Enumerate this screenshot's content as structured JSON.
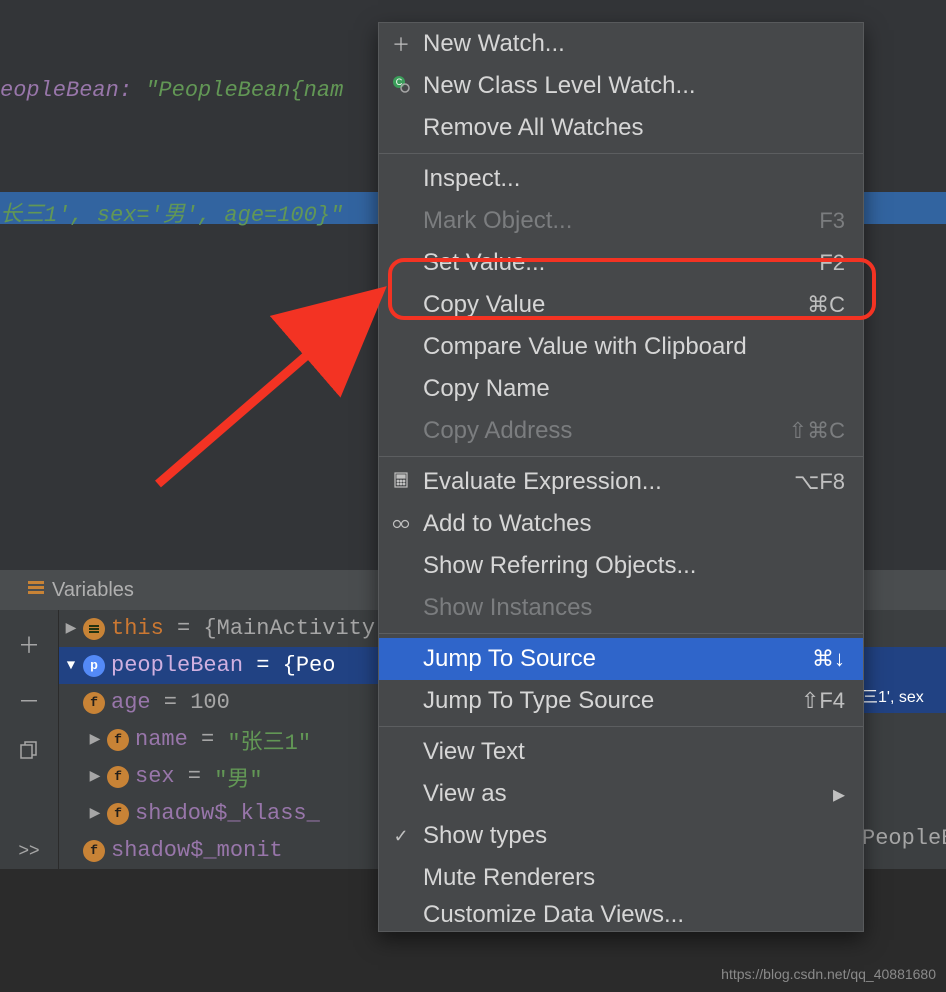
{
  "watch": {
    "line1_prefix": "eopleBean: ",
    "line1_value": "\"PeopleBean{nam",
    "line2": "长三1', sex='男', age=100}\""
  },
  "variablesPanel": {
    "title": "Variables"
  },
  "tree": {
    "this": {
      "name": "this",
      "sep": " = ",
      "value": "{MainActivity"
    },
    "peopleBean": {
      "name": "peopleBean",
      "sep": " = ",
      "value": "{Peo",
      "tail": "三1', sex"
    },
    "age": {
      "name": "age",
      "sep": " = ",
      "value": "100"
    },
    "nameF": {
      "name": "name",
      "sep": " = ",
      "value": "\"张三1\""
    },
    "sex": {
      "name": "sex",
      "sep": " = ",
      "value": "\"男\""
    },
    "klass": {
      "name": "shadow$_klass_",
      "tail": "PeopleB"
    },
    "monitor": {
      "name": "shadow$_monit"
    }
  },
  "menu": {
    "newWatch": "New Watch...",
    "newClassWatch": "New Class Level Watch...",
    "removeAll": "Remove All Watches",
    "inspect": "Inspect...",
    "markObject": "Mark Object...",
    "markObject_sc": "F3",
    "setValue": "Set Value...",
    "setValue_sc": "F2",
    "copyValue": "Copy Value",
    "copyValue_sc": "⌘C",
    "compare": "Compare Value with Clipboard",
    "copyName": "Copy Name",
    "copyAddr": "Copy Address",
    "copyAddr_sc": "⇧⌘C",
    "evalExpr": "Evaluate Expression...",
    "evalExpr_sc": "⌥F8",
    "addWatches": "Add to Watches",
    "showRef": "Show Referring Objects...",
    "showInst": "Show Instances",
    "jumpSrc": "Jump To Source",
    "jumpSrc_sc": "⌘↓",
    "jumpType": "Jump To Type Source",
    "jumpType_sc": "⇧F4",
    "viewText": "View Text",
    "viewAs": "View as",
    "showTypes": "Show types",
    "muteRend": "Mute Renderers",
    "custData": "Customize Data Views..."
  },
  "watermark": "https://blog.csdn.net/qq_40881680"
}
